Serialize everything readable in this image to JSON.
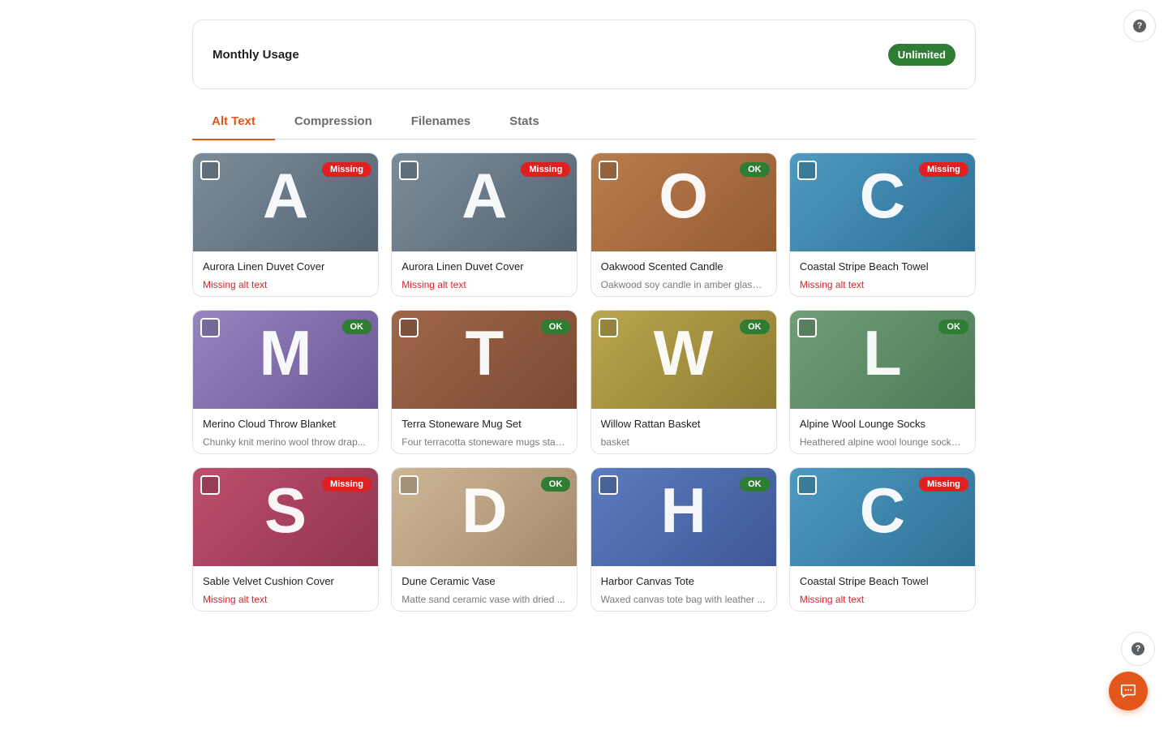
{
  "usage": {
    "title": "Monthly Usage",
    "badge": "Unlimited"
  },
  "tabs": [
    {
      "label": "Alt Text",
      "active": true
    },
    {
      "label": "Compression",
      "active": false
    },
    {
      "label": "Filenames",
      "active": false
    },
    {
      "label": "Stats",
      "active": false
    }
  ],
  "colors": {
    "accent": "#e4571c",
    "ok": "#2e7d32",
    "missing": "#e02020"
  },
  "products": [
    {
      "letter": "A",
      "status": "Missing",
      "name": "Aurora Linen Duvet Cover",
      "alt": "Missing alt text",
      "alt_missing": true,
      "color_from": "#7a8c9a",
      "color_to": "#566472"
    },
    {
      "letter": "A",
      "status": "Missing",
      "name": "Aurora Linen Duvet Cover",
      "alt": "Missing alt text",
      "alt_missing": true,
      "color_from": "#7a8c9a",
      "color_to": "#566472"
    },
    {
      "letter": "O",
      "status": "OK",
      "name": "Oakwood Scented Candle",
      "alt": "Oakwood soy candle in amber glass ...",
      "alt_missing": false,
      "color_from": "#b97c4c",
      "color_to": "#955c33"
    },
    {
      "letter": "C",
      "status": "Missing",
      "name": "Coastal Stripe Beach Towel",
      "alt": "Missing alt text",
      "alt_missing": true,
      "color_from": "#4d9ac0",
      "color_to": "#2f7096"
    },
    {
      "letter": "M",
      "status": "OK",
      "name": "Merino Cloud Throw Blanket",
      "alt": "Chunky knit merino wool throw drap...",
      "alt_missing": false,
      "color_from": "#9685be",
      "color_to": "#6b5796"
    },
    {
      "letter": "T",
      "status": "OK",
      "name": "Terra Stoneware Mug Set",
      "alt": "Four terracotta stoneware mugs stac...",
      "alt_missing": false,
      "color_from": "#a0664a",
      "color_to": "#7b4a33"
    },
    {
      "letter": "W",
      "status": "OK",
      "name": "Willow Rattan Basket",
      "alt": "basket",
      "alt_missing": false,
      "color_from": "#b9a64c",
      "color_to": "#8f7c33"
    },
    {
      "letter": "L",
      "status": "OK",
      "name": "Alpine Wool Lounge Socks",
      "alt": "Heathered alpine wool lounge socks ...",
      "alt_missing": false,
      "color_from": "#6f9f78",
      "color_to": "#4d7a57"
    },
    {
      "letter": "S",
      "status": "Missing",
      "name": "Sable Velvet Cushion Cover",
      "alt": "Missing alt text",
      "alt_missing": true,
      "color_from": "#bd4f6c",
      "color_to": "#913451"
    },
    {
      "letter": "D",
      "status": "OK",
      "name": "Dune Ceramic Vase",
      "alt": "Matte sand ceramic vase with dried ...",
      "alt_missing": false,
      "color_from": "#cdb697",
      "color_to": "#a48a6a"
    },
    {
      "letter": "H",
      "status": "OK",
      "name": "Harbor Canvas Tote",
      "alt": "Waxed canvas tote bag with leather ...",
      "alt_missing": false,
      "color_from": "#5c7bbd",
      "color_to": "#3d5898"
    },
    {
      "letter": "C",
      "status": "Missing",
      "name": "Coastal Stripe Beach Towel",
      "alt": "Missing alt text",
      "alt_missing": true,
      "color_from": "#4d9ac0",
      "color_to": "#2f7096"
    }
  ],
  "icons": {
    "help": "question-circle-icon",
    "chat": "chat-bubble-icon"
  }
}
